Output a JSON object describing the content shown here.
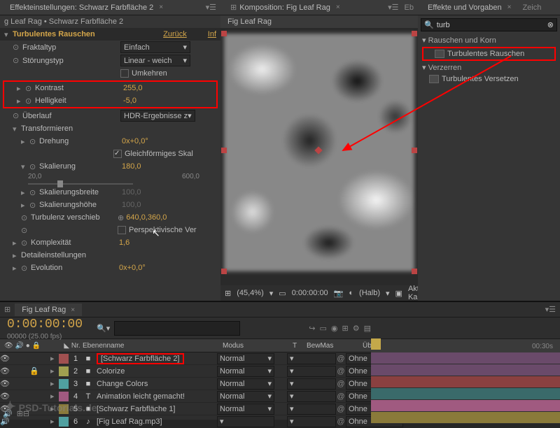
{
  "effectPanel": {
    "title": "Effekteinstellungen: Schwarz Farbfläche 2",
    "breadcrumb": "g Leaf Rag • Schwarz Farbfläche 2",
    "effectName": "Turbulentes Rauschen",
    "resetLabel": "Zurück",
    "infoLabel": "Inf",
    "props": {
      "fraktaltyp": {
        "label": "Fraktaltyp",
        "value": "Einfach"
      },
      "stoerungstyp": {
        "label": "Störungstyp",
        "value": "Linear - weich"
      },
      "umkehren": {
        "label": "Umkehren"
      },
      "kontrast": {
        "label": "Kontrast",
        "value": "255,0"
      },
      "helligkeit": {
        "label": "Helligkeit",
        "value": "-5,0"
      },
      "ueberlauf": {
        "label": "Überlauf",
        "value": "HDR-Ergebnisse z"
      },
      "transformieren": {
        "label": "Transformieren"
      },
      "drehung": {
        "label": "Drehung",
        "value": "0x+0,0°"
      },
      "gleichfoermig": {
        "label": "Gleichförmiges Skal"
      },
      "skalierung": {
        "label": "Skalierung",
        "value": "180,0"
      },
      "skalMin": "20,0",
      "skalMax": "600,0",
      "skalierungsbreite": {
        "label": "Skalierungsbreite",
        "value": "100,0"
      },
      "skalierungshoehe": {
        "label": "Skalierungshöhe",
        "value": "100,0"
      },
      "turbulenz": {
        "label": "Turbulenz verschieb",
        "value": "640,0,360,0"
      },
      "perspektiv": {
        "label": "Perspektivische Ver"
      },
      "komplexitaet": {
        "label": "Komplexität",
        "value": "1,6"
      },
      "detail": {
        "label": "Detaileinstellungen"
      },
      "evolution": {
        "label": "Evolution",
        "value": "0x+0,0°"
      }
    }
  },
  "compPanel": {
    "title": "Komposition: Fig Leaf Rag",
    "subtab": "Fig Leaf Rag",
    "adjTab": "Eb",
    "footer": {
      "zoom": "(45,4%)",
      "time": "0:00:00:00",
      "resolution": "(Halb)",
      "camera": "Aktive Kamera"
    }
  },
  "effectsLib": {
    "title": "Effekte und Vorgaben",
    "adjTab": "Zeich",
    "search": "turb",
    "groups": [
      {
        "name": "Rauschen und Korn",
        "items": [
          "Turbulentes Rauschen"
        ]
      },
      {
        "name": "Verzerren",
        "items": [
          "Turbulentes Versetzen"
        ]
      }
    ]
  },
  "timeline": {
    "compName": "Fig Leaf Rag",
    "timecode": "0:00:00:00",
    "fps": "00000 (25.00 fps)",
    "headers": {
      "nr": "Nr.",
      "name": "Ebenenname",
      "modus": "Modus",
      "t": "T",
      "bewmas": "BewMas",
      "parent": "Übergeordnet"
    },
    "ruler30s": "00:30s",
    "layers": [
      {
        "nr": "1",
        "name": "[Schwarz Farbfläche 2]",
        "mode": "Normal",
        "parent": "Ohne",
        "color": "#a05050",
        "highlighted": true,
        "locked": false
      },
      {
        "nr": "2",
        "name": "Colorize",
        "mode": "Normal",
        "parent": "Ohne",
        "color": "#a0a050",
        "locked": true
      },
      {
        "nr": "3",
        "name": "Change Colors",
        "mode": "Normal",
        "parent": "Ohne",
        "color": "#50a0a0",
        "locked": false
      },
      {
        "nr": "4",
        "name": "Animation leicht gemacht!",
        "mode": "Normal",
        "parent": "Ohne",
        "color": "#a05a80",
        "locked": false,
        "textLayer": true
      },
      {
        "nr": "5",
        "name": "[Schwarz Farbfläche 1]",
        "mode": "Normal",
        "parent": "Ohne",
        "color": "#8a7a3a",
        "locked": false
      },
      {
        "nr": "6",
        "name": "[Fig Leaf Rag.mp3]",
        "mode": "",
        "parent": "Ohne",
        "color": "#50a0a0",
        "locked": false,
        "audio": true
      }
    ]
  },
  "watermark": "PSD-Tutorials.de"
}
